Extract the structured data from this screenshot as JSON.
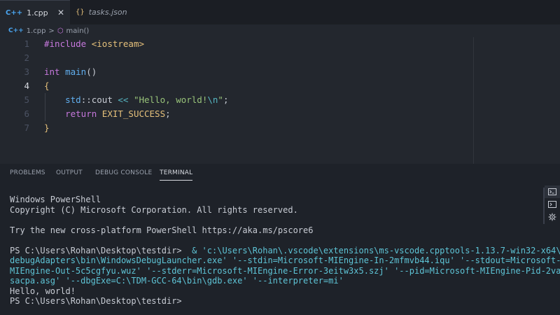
{
  "tabs": [
    {
      "label": "1.cpp",
      "icon": "C++",
      "close": "✕"
    },
    {
      "label": "tasks.json",
      "icon": "{}"
    }
  ],
  "breadcrumb": {
    "file": "1.cpp",
    "separator": ">",
    "symbol": "main()"
  },
  "editor": {
    "line_numbers": [
      "1",
      "2",
      "3",
      "4",
      "5",
      "6",
      "7"
    ],
    "code": {
      "l1_directive": "#include",
      "l1_header": "<iostream>",
      "l3_type": "int",
      "l3_fn": "main",
      "l3_parens": "()",
      "l4": "{",
      "l5_ns": "std",
      "l5_sep": "::",
      "l5_id": "cout",
      "l5_op": "<<",
      "l5_str": "\"Hello, world!",
      "l5_esc": "\\n",
      "l5_str_end": "\"",
      "l5_end": ";",
      "l6_kw": "return",
      "l6_val": "EXIT_SUCCESS",
      "l6_end": ";",
      "l7": "}"
    }
  },
  "panel": {
    "tabs": [
      "PROBLEMS",
      "OUTPUT",
      "DEBUG CONSOLE",
      "TERMINAL"
    ],
    "terminal": {
      "l1": "Windows PowerShell",
      "l2": "Copyright (C) Microsoft Corporation. All rights reserved.",
      "l3": "",
      "l4": "Try the new cross-platform PowerShell https://aka.ms/pscore6",
      "l5": "",
      "prompt": "PS C:\\Users\\Rohan\\Desktop\\testdir>",
      "cmd_l1": "  & 'c:\\Users\\Rohan\\.vscode\\extensions\\ms-vscode.cpptools-1.13.7-win32-x64\\",
      "cmd_l2": "debugAdapters\\bin\\WindowsDebugLauncher.exe' '--stdin=Microsoft-MIEngine-In-2mfmvb44.iqu' '--stdout=Microsoft-",
      "cmd_l3": "MIEngine-Out-5c5cgfyu.wuz' '--stderr=Microsoft-MIEngine-Error-3eitw3x5.szj' '--pid=Microsoft-MIEngine-Pid-2va",
      "cmd_l4": "sacpa.asg' '--dbgExe=C:\\TDM-GCC-64\\bin\\gdb.exe' '--interpreter=mi'",
      "output": "Hello, world!",
      "final_prompt": "PS C:\\Users\\Rohan\\Desktop\\testdir>"
    }
  }
}
